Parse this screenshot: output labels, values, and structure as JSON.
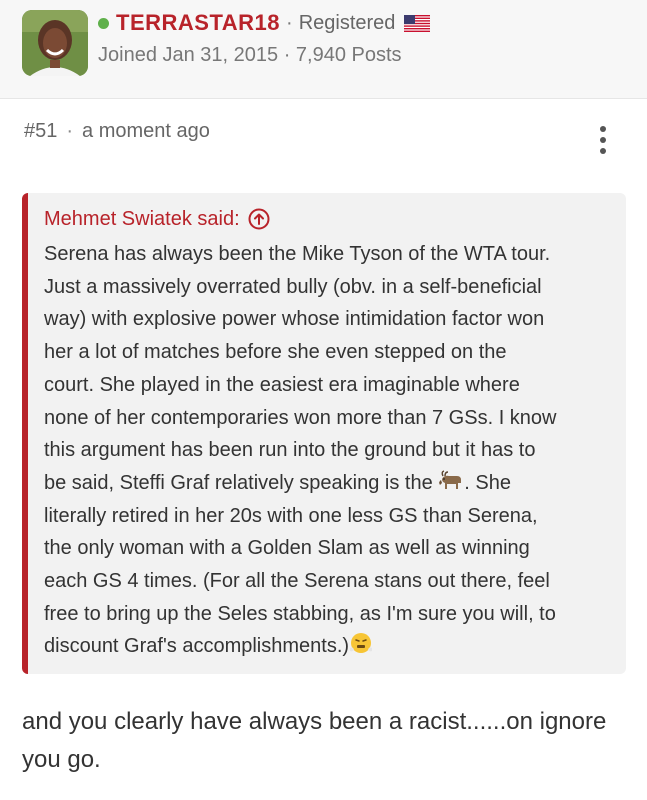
{
  "header": {
    "username": "TERRASTAR18",
    "separator": "·",
    "role": "Registered",
    "joined": "Joined Jan 31, 2015 · 7,940 Posts",
    "online_color": "#5fb04b",
    "accent_color": "#b8232a",
    "flag_icon": "us-flag-icon"
  },
  "post": {
    "number": "#51",
    "dot": "·",
    "time": "a moment ago",
    "menu_icon": "more-vertical-icon"
  },
  "quote": {
    "author": "Mehmet Swiatek said:",
    "jump_icon": "arrow-up-circle-icon",
    "lines": [
      "Serena has always been the Mike Tyson of the WTA tour.",
      "Just a massively overrated bully (obv. in a self-beneficial",
      "way) with explosive power whose intimidation factor won",
      "her a lot of matches before she even stepped on the",
      "court. She played in the easiest era imaginable where",
      "none of her contemporaries won more than 7 GSs. I know",
      "this argument has been run into the ground but it has to",
      "be said, Steffi Graf relatively speaking is the",
      ". She",
      "literally retired in her 20s with one less GS than Serena,",
      "the only woman with a Golden Slam as well as winning",
      "each GS 4 times. (For all the Serena stans out there, feel",
      "free to bring up the Seles stabbing, as I'm sure you will, to",
      "discount Graf's accomplishments.)"
    ],
    "goat_icon": "goat-emoji-icon",
    "steam_icon": "face-with-steam-emoji-icon"
  },
  "reply": {
    "line1": "and you clearly have always been a racist......on ignore",
    "line2": "you go."
  }
}
